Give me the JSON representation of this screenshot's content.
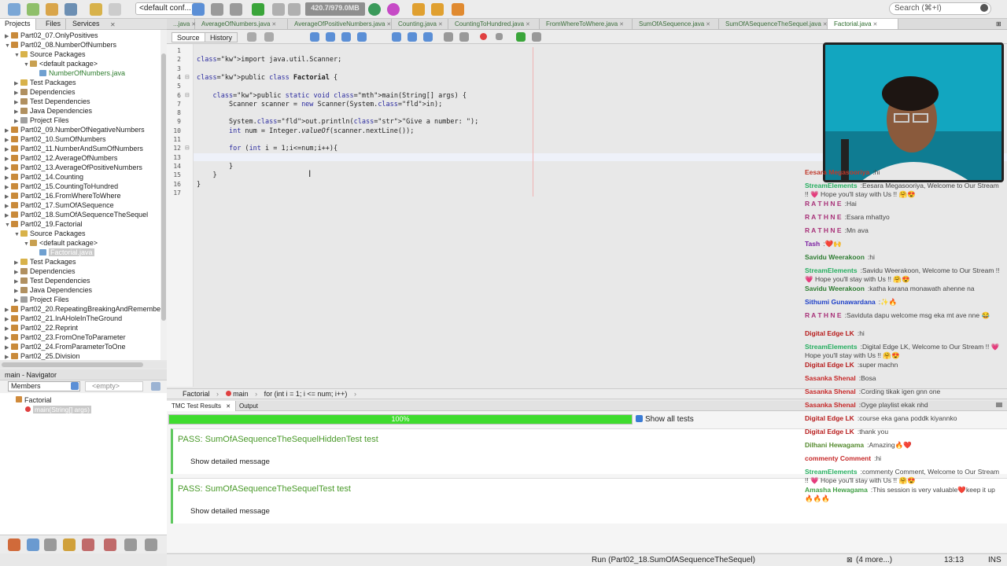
{
  "toolbar": {
    "config": "<default conf...",
    "memory": "420.7/979.0MB",
    "search_placeholder": "Search (⌘+I)"
  },
  "left_tabs": [
    "Projects",
    "Files",
    "Services"
  ],
  "tree": [
    {
      "label": "Part02_07.OnlyPositives",
      "indent": 0,
      "type": "project",
      "open": false
    },
    {
      "label": "Part02_08.NumberOfNumbers",
      "indent": 0,
      "type": "project",
      "open": true
    },
    {
      "label": "Source Packages",
      "indent": 1,
      "type": "pkgs",
      "open": true
    },
    {
      "label": "<default package>",
      "indent": 2,
      "type": "pkg",
      "open": true
    },
    {
      "label": "NumberOfNumbers.java",
      "indent": 3,
      "type": "java",
      "open": false
    },
    {
      "label": "Test Packages",
      "indent": 1,
      "type": "pkgs",
      "open": false
    },
    {
      "label": "Dependencies",
      "indent": 1,
      "type": "deps",
      "open": false
    },
    {
      "label": "Test Dependencies",
      "indent": 1,
      "type": "deps",
      "open": false
    },
    {
      "label": "Java Dependencies",
      "indent": 1,
      "type": "deps",
      "open": false
    },
    {
      "label": "Project Files",
      "indent": 1,
      "type": "files",
      "open": false
    },
    {
      "label": "Part02_09.NumberOfNegativeNumbers",
      "indent": 0,
      "type": "project",
      "open": false
    },
    {
      "label": "Part02_10.SumOfNumbers",
      "indent": 0,
      "type": "project",
      "open": false
    },
    {
      "label": "Part02_11.NumberAndSumOfNumbers",
      "indent": 0,
      "type": "project",
      "open": false
    },
    {
      "label": "Part02_12.AverageOfNumbers",
      "indent": 0,
      "type": "project",
      "open": false
    },
    {
      "label": "Part02_13.AverageOfPositiveNumbers",
      "indent": 0,
      "type": "project",
      "open": false
    },
    {
      "label": "Part02_14.Counting",
      "indent": 0,
      "type": "project",
      "open": false
    },
    {
      "label": "Part02_15.CountingToHundred",
      "indent": 0,
      "type": "project",
      "open": false
    },
    {
      "label": "Part02_16.FromWhereToWhere",
      "indent": 0,
      "type": "project",
      "open": false
    },
    {
      "label": "Part02_17.SumOfASequence",
      "indent": 0,
      "type": "project",
      "open": false
    },
    {
      "label": "Part02_18.SumOfASequenceTheSequel",
      "indent": 0,
      "type": "project",
      "open": false
    },
    {
      "label": "Part02_19.Factorial",
      "indent": 0,
      "type": "project",
      "open": true
    },
    {
      "label": "Source Packages",
      "indent": 1,
      "type": "pkgs",
      "open": true
    },
    {
      "label": "<default package>",
      "indent": 2,
      "type": "pkg",
      "open": true
    },
    {
      "label": "Factorial.java",
      "indent": 3,
      "type": "java-selected",
      "open": false
    },
    {
      "label": "Test Packages",
      "indent": 1,
      "type": "pkgs",
      "open": false
    },
    {
      "label": "Dependencies",
      "indent": 1,
      "type": "deps",
      "open": false
    },
    {
      "label": "Test Dependencies",
      "indent": 1,
      "type": "deps",
      "open": false
    },
    {
      "label": "Java Dependencies",
      "indent": 1,
      "type": "deps",
      "open": false
    },
    {
      "label": "Project Files",
      "indent": 1,
      "type": "files",
      "open": false
    },
    {
      "label": "Part02_20.RepeatingBreakingAndRemembe",
      "indent": 0,
      "type": "project",
      "open": false
    },
    {
      "label": "Part02_21.InAHoleInTheGround",
      "indent": 0,
      "type": "project",
      "open": false
    },
    {
      "label": "Part02_22.Reprint",
      "indent": 0,
      "type": "project",
      "open": false
    },
    {
      "label": "Part02_23.FromOneToParameter",
      "indent": 0,
      "type": "project",
      "open": false
    },
    {
      "label": "Part02_24.FromParameterToOne",
      "indent": 0,
      "type": "project",
      "open": false
    },
    {
      "label": "Part02_25.Division",
      "indent": 0,
      "type": "project",
      "open": false
    }
  ],
  "navigator": {
    "title": "main - Navigator",
    "members": "Members",
    "filter": "<empty>",
    "class": "Factorial",
    "method": "main(String[] args)"
  },
  "editor_tabs": [
    {
      "label": "...java",
      "active": false
    },
    {
      "label": "AverageOfNumbers.java",
      "active": false
    },
    {
      "label": "AverageOfPositiveNumbers.java",
      "active": false
    },
    {
      "label": "Counting.java",
      "active": false
    },
    {
      "label": "CountingToHundred.java",
      "active": false
    },
    {
      "label": "FromWhereToWhere.java",
      "active": false
    },
    {
      "label": "SumOfASequence.java",
      "active": false
    },
    {
      "label": "SumOfASequenceTheSequel.java",
      "active": false
    },
    {
      "label": "Factorial.java",
      "active": true
    }
  ],
  "editor_toolbar": {
    "source": "Source",
    "history": "History"
  },
  "code_lines": [
    "",
    "import java.util.Scanner;",
    "",
    "public class Factorial {",
    "",
    "    public static void main(String[] args) {",
    "        Scanner scanner = new Scanner(System.in);",
    "",
    "        System.out.println(\"Give a number: \");",
    "        int num = Integer.valueOf(scanner.nextLine());",
    "",
    "        for (int i = 1;i<=num;i++){",
    "",
    "        }",
    "    }",
    "}",
    ""
  ],
  "breadcrumb": [
    "Factorial",
    "main",
    "for (int i = 1; i <= num; i++)"
  ],
  "output_tabs": [
    "TMC Test Results",
    "Output"
  ],
  "progress": {
    "percent": 100,
    "label": "100%"
  },
  "show_all_tests": "Show all tests",
  "results": [
    {
      "title": "PASS: SumOfASequenceTheSequelHiddenTest test",
      "button": "Show detailed message"
    },
    {
      "title": "PASS: SumOfASequenceTheSequelTest test",
      "button": "Show detailed message"
    }
  ],
  "status": {
    "run": "Run (Part02_18.SumOfASequenceTheSequel)",
    "more": "(4 more...)",
    "position": "13:13",
    "mode": "INS"
  },
  "chat": [
    {
      "user": "Eesara Megasooriya",
      "text": "hi",
      "color": "#c0392b"
    },
    {
      "user": "StreamElements",
      "text": "Eesara Megasooriya, Welcome to Our Stream !! 💗 Hope you'll stay with Us !! 🤗😍",
      "color": "#27ae60"
    },
    {
      "user": "R A T H N E",
      "text": "Hai",
      "color": "#a83279"
    },
    {
      "user": "R A T H N E",
      "text": "Esara mhattyo",
      "color": "#a83279"
    },
    {
      "user": "R A T H N E",
      "text": "Mn ava",
      "color": "#a83279"
    },
    {
      "user": "Tash",
      "text": "❤️🙌",
      "color": "#7b1fa2"
    },
    {
      "user": "Savidu Weerakoon",
      "text": "hi",
      "color": "#2e7d32"
    },
    {
      "user": "StreamElements",
      "text": "Savidu Weerakoon, Welcome to Our Stream !! 💗 Hope you'll stay with Us !! 🤗😍",
      "color": "#27ae60"
    },
    {
      "user": "Savidu Weerakoon",
      "text": "katha karana monawath ahenne na",
      "color": "#2e7d32"
    },
    {
      "user": "Sithumi Gunawardana",
      "text": "✨🔥",
      "color": "#1e40c8"
    },
    {
      "user": "R A T H N E",
      "text": "Saviduta dapu welcome msg eka mt ave nne 😂",
      "color": "#a83279"
    },
    {
      "user": "Digital Edge LK",
      "text": "hi",
      "color": "#b71c1c"
    },
    {
      "user": "StreamElements",
      "text": "Digital Edge LK, Welcome to Our Stream !! 💗 Hope you'll stay with Us !! 🤗😍",
      "color": "#27ae60"
    },
    {
      "user": "Digital Edge LK",
      "text": "super machn",
      "color": "#b71c1c"
    },
    {
      "user": "Sasanka Shenal",
      "text": "Bosa",
      "color": "#c62828"
    },
    {
      "user": "Sasanka Shenal",
      "text": "Cording tikak igen gnn one",
      "color": "#c62828"
    },
    {
      "user": "Sasanka Shenal",
      "text": "Oyge playlist ekak nhd",
      "color": "#c62828"
    },
    {
      "user": "Digital Edge LK",
      "text": "course eka gana poddk kiyannko",
      "color": "#b71c1c"
    },
    {
      "user": "Digital Edge LK",
      "text": "thank you",
      "color": "#b71c1c"
    },
    {
      "user": "Dilhani Hewagama",
      "text": "Amazing🔥❤️",
      "color": "#558b2f"
    },
    {
      "user": "commenty Comment",
      "text": "hi",
      "color": "#c62828"
    },
    {
      "user": "StreamElements",
      "text": "commenty Comment, Welcome to Our Stream !! 💗 Hope you'll stay with Us !! 🤗😍",
      "color": "#27ae60"
    },
    {
      "user": "Amasha Hewagama",
      "text": "This session is very valuable❤️keep it up🔥🔥🔥",
      "color": "#43a047"
    }
  ],
  "colors": {
    "accent_green": "#3fdc2e",
    "pass_green": "#4a9a2a",
    "webcam_bg": "#0d9cb5"
  }
}
